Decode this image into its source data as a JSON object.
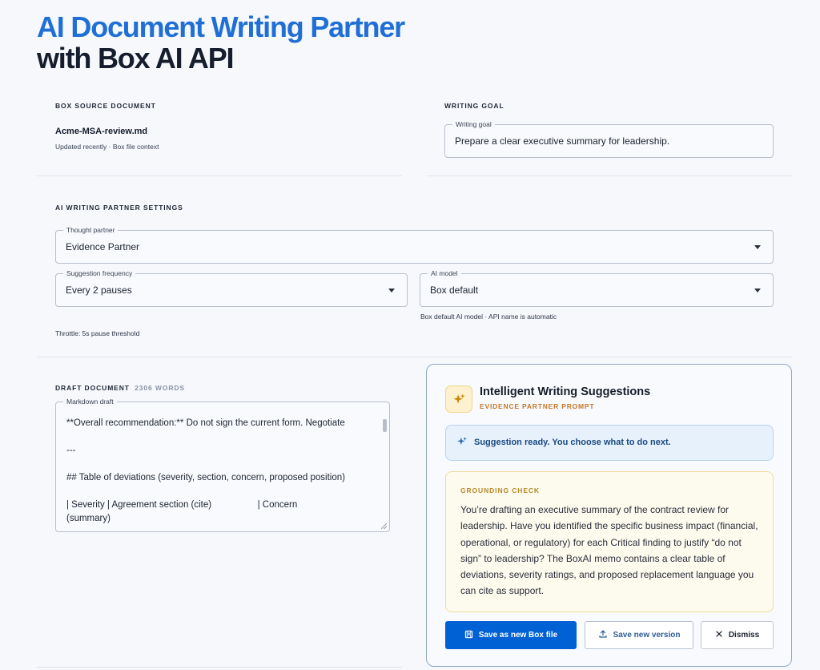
{
  "header": {
    "title_line1": "AI Document Writing Partner",
    "title_line2": "with Box AI API"
  },
  "source_document": {
    "section_label": "BOX SOURCE DOCUMENT",
    "file_name": "Acme-MSA-review.md",
    "meta": "Updated recently · Box file context"
  },
  "writing_goal": {
    "section_label": "WRITING GOAL",
    "field_label": "Writing goal",
    "value": "Prepare a clear executive summary for leadership."
  },
  "settings": {
    "section_label": "AI WRITING PARTNER SETTINGS",
    "thought_partner": {
      "label": "Thought partner",
      "value": "Evidence Partner"
    },
    "suggestion_frequency": {
      "label": "Suggestion frequency",
      "value": "Every 2 pauses"
    },
    "ai_model": {
      "label": "AI model",
      "value": "Box default",
      "helper": "Box default AI model · API name is automatic"
    },
    "throttle": "Throttle: 5s pause threshold"
  },
  "draft": {
    "section_label": "DRAFT DOCUMENT",
    "word_count": "2306 WORDS",
    "field_label": "Markdown draft",
    "content": "**Overall recommendation:** Do not sign the current form. Negotiate\n\n---\n\n## Table of deviations (severity, section, concern, proposed position)\n\n| Severity | Agreement section (cite)                  | Concern\n(summary)"
  },
  "suggestions": {
    "title": "Intelligent Writing Suggestions",
    "subtitle": "EVIDENCE PARTNER PROMPT",
    "icon": "sparkle-icon",
    "ready_text": "Suggestion ready. You choose what to do next.",
    "grounding_label": "GROUNDING CHECK",
    "grounding_text": "You’re drafting an executive summary of the contract review for leadership. Have you identified the specific business impact (financial, operational, or regulatory) for each Critical finding to justify “do not sign” to leadership? The BoxAI memo contains a clear table of deviations, severity ratings, and proposed replacement language you can cite as support.",
    "buttons": {
      "save_new": "Save as new Box file",
      "save_version": "Save new version",
      "dismiss": "Dismiss"
    }
  },
  "colors": {
    "brand_blue": "#1f6fd6",
    "primary_button": "#0061d5",
    "accent_orange": "#c4772a"
  }
}
